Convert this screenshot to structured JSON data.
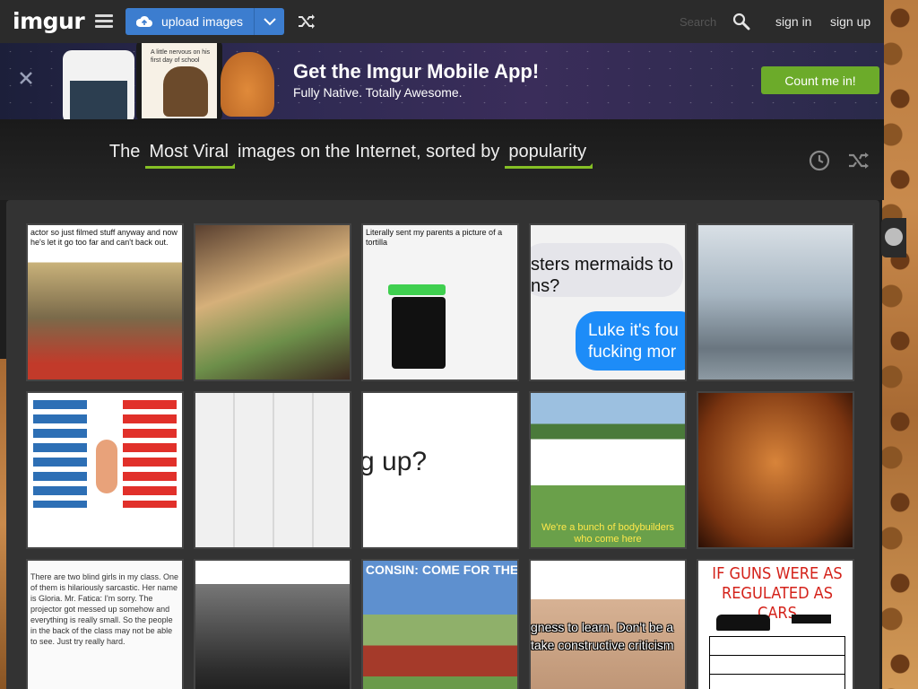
{
  "header": {
    "logo": "imgur",
    "upload_label": "upload images",
    "search_placeholder": "Search",
    "signin": "sign in",
    "signup": "sign up"
  },
  "promo": {
    "title": "Get the Imgur Mobile App!",
    "subtitle": "Fully Native. Totally Awesome.",
    "cta": "Count me in!",
    "phone_caption": "A little nervous on his first day of school"
  },
  "headline": {
    "prefix": "The",
    "section": "Most Viral",
    "middle": "images on the Internet, sorted by",
    "sort": "popularity"
  },
  "tiles": [
    {
      "caption": "actor so just filmed stuff anyway and now he's let it go too far and can't back out.",
      "bg": "#d9c9a3"
    },
    {
      "caption": "",
      "bg": "#8b6b4a"
    },
    {
      "caption": "Literally sent my parents a picture of a tortilla",
      "bg": "#f2f2f2"
    },
    {
      "caption": "sters mermaids to ns?   Luke it's fou fucking mor",
      "bg": "#eaeaea"
    },
    {
      "caption": "",
      "bg": "#b7c1c8"
    },
    {
      "caption": "",
      "bg": "#f4f4f4"
    },
    {
      "caption": "",
      "bg": "#f0f0f0"
    },
    {
      "caption": "g up?",
      "bg": "#ffffff"
    },
    {
      "caption": "We're a bunch of bodybuilders who come here",
      "bg": "#7aa35a"
    },
    {
      "caption": "",
      "bg": "#a5521e"
    },
    {
      "caption": "There are two blind girls in my class. One of them is hilariously sarcastic. Her name is Gloria. Mr. Fatica: I'm sorry. The projector got messed up somehow and everything is really small. So the people in the back of the class may not be able to see. Just try really hard.",
      "bg": "#f7f7f7"
    },
    {
      "caption": "",
      "bg": "#3d3d3d"
    },
    {
      "caption": "CONSIN: COME FOR THE ... BECAUSE YOUR MOBILITY SCOOTER",
      "bg": "#5f8fcc"
    },
    {
      "caption": "gness to learn. Don't be a take constructive criticism",
      "bg": "#d3b59a"
    },
    {
      "caption": "IF GUNS WERE AS REGULATED AS CARS",
      "bg": "#ffffff"
    }
  ],
  "colors": {
    "accent_green": "#85bf25",
    "upload_blue": "#3c7dcf",
    "cta_green": "#6cab2a"
  }
}
